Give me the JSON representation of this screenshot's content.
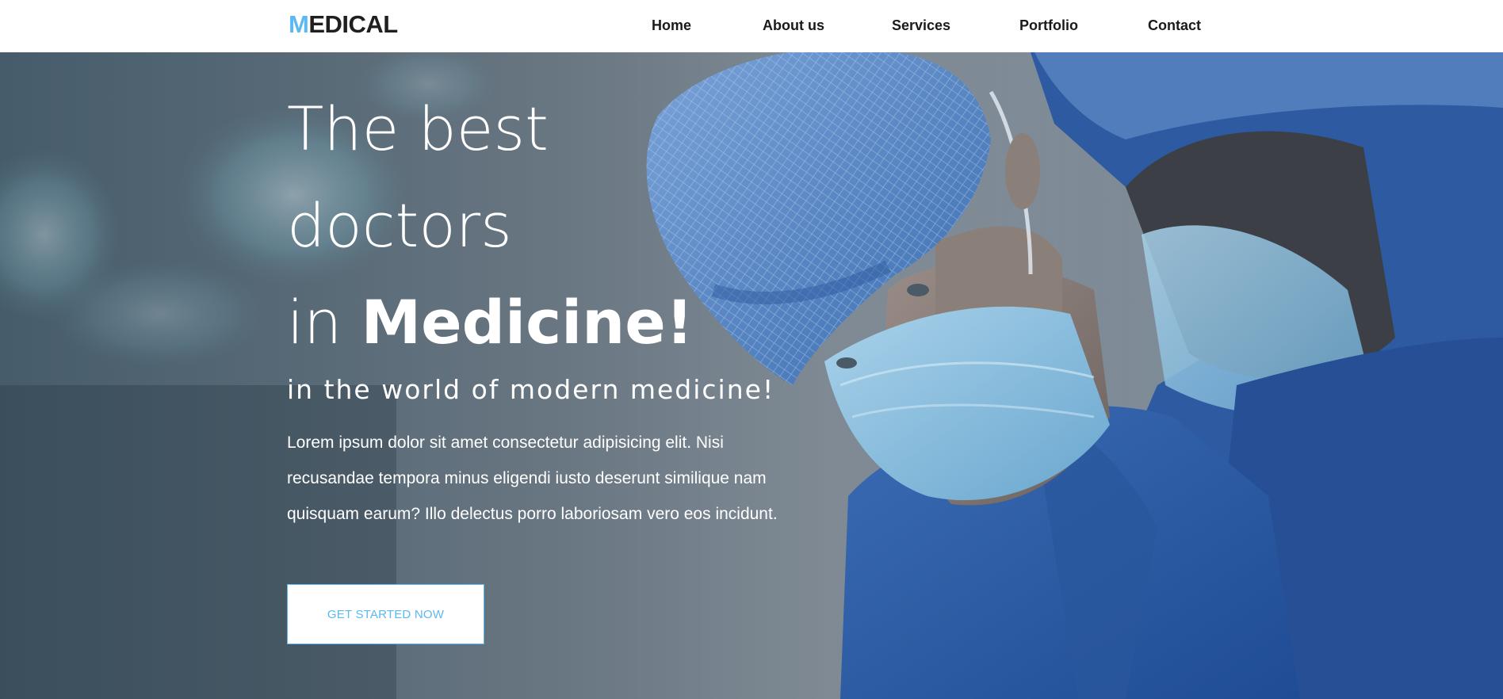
{
  "header": {
    "logo_first": "M",
    "logo_rest": "EDICAL",
    "nav": [
      {
        "label": "Home"
      },
      {
        "label": "About us"
      },
      {
        "label": "Services"
      },
      {
        "label": "Portfolio"
      },
      {
        "label": "Contact"
      }
    ]
  },
  "hero": {
    "headline_line1": "The best",
    "headline_line2": "doctors",
    "headline_line3_prefix": "in ",
    "headline_line3_strong": "Medicine!",
    "subheadline": "in the world of modern medicine!",
    "body": "Lorem ipsum dolor sit amet consectetur adipisicing elit. Nisi recusandae tempora minus eligendi iusto deserunt similique nam quisquam earum? Illo delectus porro laboriosam vero eos incidunt.",
    "cta_label": "GET STARTED NOW",
    "background_image": "surgeons-in-operating-room-photo"
  },
  "colors": {
    "accent": "#5bb8f0",
    "header_bg": "#ffffff",
    "text_dark": "#1a1a1a",
    "hero_text": "#ffffff"
  }
}
